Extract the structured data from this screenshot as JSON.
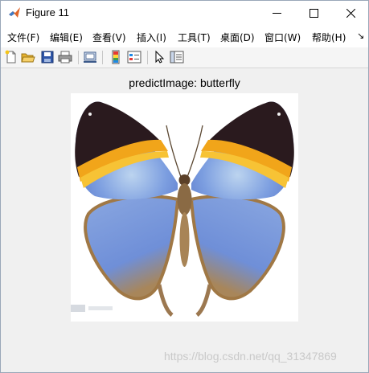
{
  "window": {
    "title": "Figure 11"
  },
  "menu": {
    "items": [
      "文件(F)",
      "编辑(E)",
      "查看(V)",
      "插入(I)",
      "工具(T)",
      "桌面(D)",
      "窗口(W)",
      "帮助(H)"
    ],
    "overflow": "↘"
  },
  "toolbar": {
    "icons": [
      "new-figure-icon",
      "open-file-icon",
      "save-icon",
      "print-icon",
      "link-plot-icon",
      "insert-colorbar-icon",
      "insert-legend-icon",
      "pointer-icon",
      "property-inspector-icon"
    ]
  },
  "figure": {
    "title": "predictImage: butterfly",
    "image_subject": "butterfly",
    "watermark": "https://blog.csdn.net/qq_31347869"
  }
}
